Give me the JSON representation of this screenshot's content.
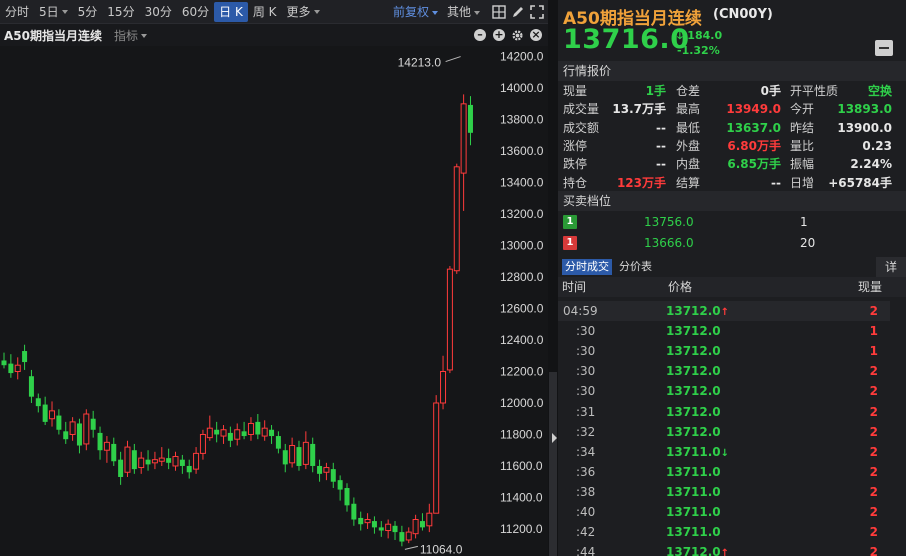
{
  "toolbar": {
    "periods": [
      "分时",
      "5日",
      "5分",
      "15分",
      "30分",
      "60分",
      "日 K",
      "周 K",
      "更多"
    ],
    "active_period": "日 K",
    "adjust_label": "前复权",
    "other_label": "其他"
  },
  "chart_header": {
    "title": "A50期指当月连续",
    "indicator_label": "指标"
  },
  "chart_data": {
    "type": "candlestick",
    "y_ticks": [
      "14200.0",
      "14000.0",
      "13800.0",
      "13600.0",
      "13400.0",
      "13200.0",
      "13000.0",
      "12800.0",
      "12600.0",
      "12400.0",
      "12200.0",
      "12000.0",
      "11800.0",
      "11600.0",
      "11400.0",
      "11200.0"
    ],
    "ylim": [
      11064,
      14213
    ],
    "annotations": {
      "high_label": "14213.0",
      "low_label": "11064.0"
    },
    "candles": [
      [
        12270,
        12240,
        12320,
        12220
      ],
      [
        12250,
        12190,
        12310,
        12160
      ],
      [
        12200,
        12240,
        12290,
        12150
      ],
      [
        12330,
        12260,
        12370,
        12210
      ],
      [
        12170,
        12040,
        12210,
        12000
      ],
      [
        12030,
        11980,
        12060,
        11940
      ],
      [
        11990,
        11880,
        12040,
        11860
      ],
      [
        11900,
        11950,
        12010,
        11850
      ],
      [
        11920,
        11830,
        11960,
        11800
      ],
      [
        11820,
        11770,
        11880,
        11740
      ],
      [
        11800,
        11880,
        11910,
        11760
      ],
      [
        11870,
        11730,
        11900,
        11680
      ],
      [
        11740,
        11930,
        11960,
        11700
      ],
      [
        11900,
        11830,
        11950,
        11780
      ],
      [
        11810,
        11700,
        11850,
        11640
      ],
      [
        11700,
        11750,
        11790,
        11620
      ],
      [
        11740,
        11630,
        11780,
        11600
      ],
      [
        11640,
        11530,
        11690,
        11480
      ],
      [
        11560,
        11720,
        11760,
        11530
      ],
      [
        11700,
        11580,
        11740,
        11550
      ],
      [
        11590,
        11650,
        11690,
        11550
      ],
      [
        11640,
        11610,
        11700,
        11570
      ],
      [
        11620,
        11640,
        11690,
        11580
      ],
      [
        11630,
        11650,
        11720,
        11600
      ],
      [
        11650,
        11620,
        11710,
        11580
      ],
      [
        11600,
        11660,
        11690,
        11570
      ],
      [
        11640,
        11600,
        11670,
        11550
      ],
      [
        11600,
        11560,
        11640,
        11520
      ],
      [
        11580,
        11680,
        11720,
        11550
      ],
      [
        11680,
        11800,
        11830,
        11640
      ],
      [
        11780,
        11840,
        11920,
        11760
      ],
      [
        11830,
        11800,
        11880,
        11750
      ],
      [
        11790,
        11830,
        11860,
        11740
      ],
      [
        11810,
        11760,
        11850,
        11720
      ],
      [
        11770,
        11830,
        11870,
        11730
      ],
      [
        11820,
        11790,
        11880,
        11770
      ],
      [
        11800,
        11870,
        11910,
        11760
      ],
      [
        11880,
        11800,
        11930,
        11770
      ],
      [
        11790,
        11840,
        11890,
        11760
      ],
      [
        11830,
        11790,
        11860,
        11740
      ],
      [
        11790,
        11710,
        11820,
        11680
      ],
      [
        11700,
        11610,
        11740,
        11560
      ],
      [
        11620,
        11730,
        11780,
        11590
      ],
      [
        11720,
        11600,
        11760,
        11570
      ],
      [
        11610,
        11750,
        11820,
        11580
      ],
      [
        11740,
        11600,
        11780,
        11560
      ],
      [
        11600,
        11550,
        11640,
        11500
      ],
      [
        11560,
        11590,
        11620,
        11510
      ],
      [
        11580,
        11500,
        11620,
        11460
      ],
      [
        11510,
        11450,
        11540,
        11380
      ],
      [
        11460,
        11350,
        11490,
        11310
      ],
      [
        11360,
        11260,
        11400,
        11220
      ],
      [
        11270,
        11230,
        11310,
        11190
      ],
      [
        11240,
        11260,
        11300,
        11200
      ],
      [
        11250,
        11210,
        11280,
        11170
      ],
      [
        11210,
        11190,
        11250,
        11150
      ],
      [
        11190,
        11230,
        11260,
        11140
      ],
      [
        11220,
        11180,
        11250,
        11130
      ],
      [
        11180,
        11120,
        11220,
        11090
      ],
      [
        11130,
        11180,
        11210,
        11110
      ],
      [
        11170,
        11260,
        11290,
        11140
      ],
      [
        11250,
        11210,
        11300,
        11190
      ],
      [
        11220,
        11300,
        11360,
        11180
      ],
      [
        11300,
        12000,
        12050,
        11300
      ],
      [
        12000,
        12200,
        12300,
        11960
      ],
      [
        12210,
        12850,
        12870,
        12190
      ],
      [
        12840,
        13500,
        13520,
        12820
      ],
      [
        13460,
        13900,
        13960,
        13220
      ],
      [
        13893,
        13716,
        13949,
        13637
      ]
    ]
  },
  "quote": {
    "name": "A50期指当月连续",
    "code": "(CN00Y)",
    "price": "13716.0",
    "change": "-184.0",
    "change_pct": "-1.32%",
    "sections": {
      "market": "行情报价",
      "orderbook": "买卖档位"
    },
    "rows": [
      [
        {
          "label": "现量",
          "value": "1手",
          "color": "green"
        },
        {
          "label": "仓差",
          "value": "0手",
          "color": "white"
        },
        {
          "label": "开平性质",
          "value": "空换",
          "color": "green"
        }
      ],
      [
        {
          "label": "成交量",
          "value": "13.7万手",
          "color": "white"
        },
        {
          "label": "最高",
          "value": "13949.0",
          "color": "red"
        },
        {
          "label": "今开",
          "value": "13893.0",
          "color": "green"
        }
      ],
      [
        {
          "label": "成交额",
          "value": "--",
          "color": "white"
        },
        {
          "label": "最低",
          "value": "13637.0",
          "color": "green"
        },
        {
          "label": "昨结",
          "value": "13900.0",
          "color": "white"
        }
      ],
      [
        {
          "label": "涨停",
          "value": "--",
          "color": "white"
        },
        {
          "label": "外盘",
          "value": "6.80万手",
          "color": "red"
        },
        {
          "label": "量比",
          "value": "0.23",
          "color": "white"
        }
      ],
      [
        {
          "label": "跌停",
          "value": "--",
          "color": "white"
        },
        {
          "label": "内盘",
          "value": "6.85万手",
          "color": "green"
        },
        {
          "label": "振幅",
          "value": "2.24%",
          "color": "white"
        }
      ],
      [
        {
          "label": "持仓",
          "value": "123万手",
          "color": "red"
        },
        {
          "label": "结算",
          "value": "--",
          "color": "white"
        },
        {
          "label": "日增",
          "value": "+65784手",
          "color": "white"
        }
      ]
    ],
    "orderbook": [
      {
        "level": "1",
        "price": "13756.0",
        "volume": "1",
        "side": "sell"
      },
      {
        "level": "1",
        "price": "13666.0",
        "volume": "20",
        "side": "buy"
      }
    ]
  },
  "trades": {
    "tabs": [
      "分时成交",
      "分价表"
    ],
    "active_tab": "分时成交",
    "detail_label": "详",
    "headers": [
      "时间",
      "价格",
      "现量"
    ],
    "rows": [
      {
        "time": "04:59",
        "price": "13712.0",
        "mark": "up",
        "vol": "2"
      },
      {
        "time": ":30",
        "price": "13712.0",
        "mark": "",
        "vol": "1"
      },
      {
        "time": ":30",
        "price": "13712.0",
        "mark": "",
        "vol": "1"
      },
      {
        "time": ":30",
        "price": "13712.0",
        "mark": "",
        "vol": "2"
      },
      {
        "time": ":30",
        "price": "13712.0",
        "mark": "",
        "vol": "2"
      },
      {
        "time": ":31",
        "price": "13712.0",
        "mark": "",
        "vol": "2"
      },
      {
        "time": ":32",
        "price": "13712.0",
        "mark": "",
        "vol": "2"
      },
      {
        "time": ":34",
        "price": "13711.0",
        "mark": "down",
        "vol": "2"
      },
      {
        "time": ":36",
        "price": "13711.0",
        "mark": "",
        "vol": "2"
      },
      {
        "time": ":38",
        "price": "13711.0",
        "mark": "",
        "vol": "2"
      },
      {
        "time": ":40",
        "price": "13711.0",
        "mark": "",
        "vol": "2"
      },
      {
        "time": ":42",
        "price": "13711.0",
        "mark": "",
        "vol": "2"
      },
      {
        "time": ":44",
        "price": "13712.0",
        "mark": "up",
        "vol": "2"
      }
    ]
  },
  "colors": {
    "up": "#ff3b3b",
    "down": "#2fd04a",
    "accent": "#2c5aa8",
    "title": "#f0a23a"
  }
}
